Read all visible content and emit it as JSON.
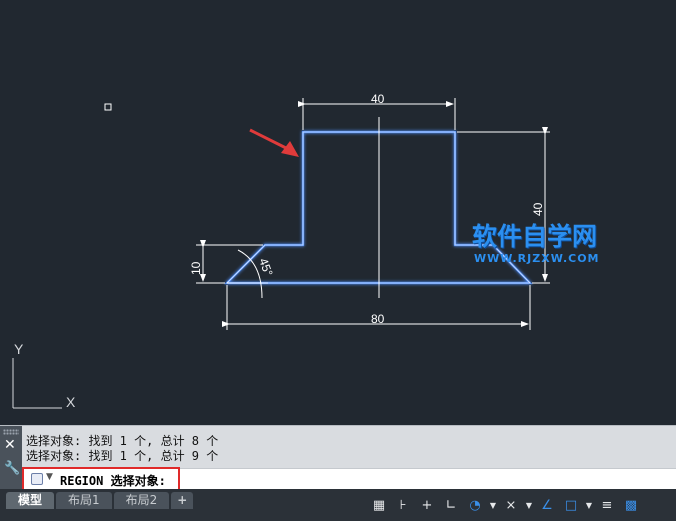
{
  "drawing": {
    "dim_top": "40",
    "dim_right": "40",
    "dim_left": "10",
    "dim_angle": "45°",
    "dim_bottom": "80",
    "ucs_y": "Y",
    "ucs_x": "X"
  },
  "watermark": {
    "title": "软件自学网",
    "url": "WWW.RJZXW.COM"
  },
  "command": {
    "history": [
      "选择对象: 找到 1 个, 总计 8 个",
      "选择对象: 找到 1 个, 总计 9 个"
    ],
    "prompt": "REGION 选择对象:",
    "close_icon": "close-icon",
    "customize_icon": "wrench-icon"
  },
  "layout_tabs": [
    "模型",
    "布局1",
    "布局2",
    "+"
  ],
  "status_tools": [
    "grid-icon",
    "snap-icon",
    "infer-icon",
    "ortho-icon",
    "polar-icon",
    "isodraft-icon",
    "osnap-icon",
    "lineweight-icon",
    "transparency-icon",
    "selection-cycle-icon",
    "annotation-icon"
  ],
  "colors": {
    "canvas_bg": "#212830",
    "outline": "#4f8ef7",
    "highlight_box": "#e02a2a",
    "arrow": "#e03b3b"
  }
}
